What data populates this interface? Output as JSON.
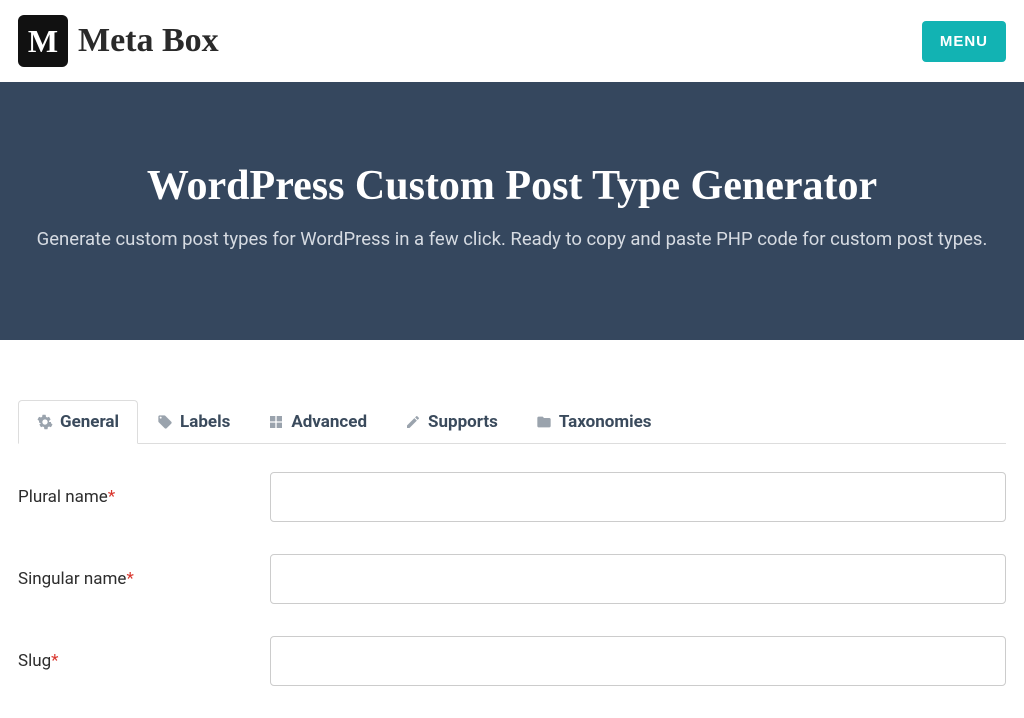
{
  "header": {
    "logo_letter": "M",
    "logo_text": "Meta Box",
    "menu_label": "MENU"
  },
  "hero": {
    "title": "WordPress Custom Post Type Generator",
    "subtitle": "Generate custom post types for WordPress in a few click. Ready to copy and paste PHP code for custom post types."
  },
  "tabs": {
    "general": "General",
    "labels": "Labels",
    "advanced": "Advanced",
    "supports": "Supports",
    "taxonomies": "Taxonomies"
  },
  "form": {
    "plural_label": "Plural name",
    "plural_value": "",
    "singular_label": "Singular name",
    "singular_value": "",
    "slug_label": "Slug",
    "slug_value": ""
  }
}
